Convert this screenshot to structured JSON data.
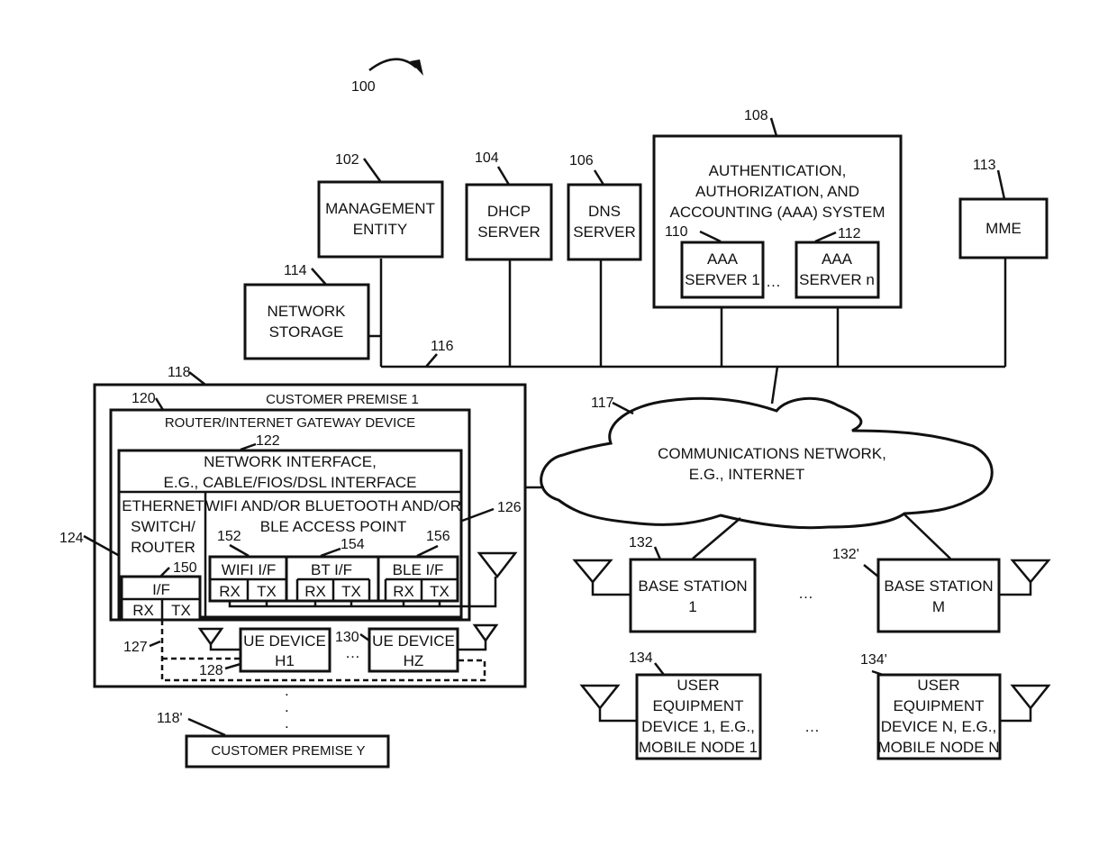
{
  "figure": {
    "ref": "100"
  },
  "nodes": {
    "management_entity": {
      "ref": "102",
      "lines": [
        "MANAGEMENT",
        "ENTITY"
      ]
    },
    "dhcp_server": {
      "ref": "104",
      "lines": [
        "DHCP",
        "SERVER"
      ]
    },
    "dns_server": {
      "ref": "106",
      "lines": [
        "DNS",
        "SERVER"
      ]
    },
    "aaa_system": {
      "ref": "108",
      "lines": [
        "AUTHENTICATION,",
        "AUTHORIZATION, AND",
        "ACCOUNTING (AAA) SYSTEM"
      ]
    },
    "aaa_server_1": {
      "ref": "110",
      "lines": [
        "AAA",
        "SERVER 1"
      ]
    },
    "aaa_server_n": {
      "ref": "112",
      "lines": [
        "AAA",
        "SERVER n"
      ]
    },
    "aaa_ellipsis": "…",
    "mme": {
      "ref": "113",
      "lines": [
        "MME"
      ]
    },
    "network_storage": {
      "ref": "114",
      "lines": [
        "NETWORK",
        "STORAGE"
      ]
    },
    "bus": {
      "ref": "116"
    },
    "comm_network": {
      "ref": "117",
      "lines": [
        "COMMUNICATIONS NETWORK,",
        "E.G., INTERNET"
      ]
    },
    "customer_premise_1": {
      "ref": "118",
      "title": "CUSTOMER PREMISE 1"
    },
    "router_gateway": {
      "ref": "120",
      "title": "ROUTER/INTERNET GATEWAY DEVICE"
    },
    "network_interface": {
      "ref": "122",
      "lines": [
        "NETWORK INTERFACE,",
        "E.G., CABLE/FIOS/DSL INTERFACE"
      ]
    },
    "ethernet_switch": {
      "ref": "124",
      "lines": [
        "ETHERNET",
        "SWITCH/",
        "ROUTER"
      ]
    },
    "access_point": {
      "ref": "126",
      "lines": [
        "WIFI AND/OR BLUETOOTH AND/OR",
        "BLE ACCESS POINT"
      ]
    },
    "wired_link": {
      "ref": "127"
    },
    "ue_device_h1": {
      "ref": "128",
      "lines": [
        "UE DEVICE",
        "H1"
      ]
    },
    "ue_device_hz": {
      "ref": "130",
      "lines": [
        "UE DEVICE",
        "HZ"
      ]
    },
    "ue_ellipsis": "…",
    "eth_if": {
      "ref": "150",
      "label": "I/F",
      "rx": "RX",
      "tx": "TX"
    },
    "wifi_if": {
      "ref": "152",
      "label": "WIFI I/F",
      "rx": "RX",
      "tx": "TX"
    },
    "bt_if": {
      "ref": "154",
      "label": "BT I/F",
      "rx": "RX",
      "tx": "TX"
    },
    "ble_if": {
      "ref": "156",
      "label": "BLE I/F",
      "rx": "RX",
      "tx": "TX"
    },
    "premise_ellipsis": [
      ".",
      ".",
      "."
    ],
    "customer_premise_y": {
      "ref": "118'",
      "title": "CUSTOMER PREMISE Y"
    },
    "base_station_1": {
      "ref": "132",
      "lines": [
        "BASE STATION",
        "1"
      ]
    },
    "base_station_m": {
      "ref": "132'",
      "lines": [
        "BASE STATION",
        "M"
      ]
    },
    "bs_ellipsis": "…",
    "ue_1": {
      "ref": "134",
      "lines": [
        "USER",
        "EQUIPMENT",
        "DEVICE 1, E.G.,",
        "MOBILE NODE 1"
      ]
    },
    "ue_n": {
      "ref": "134'",
      "lines": [
        "USER",
        "EQUIPMENT",
        "DEVICE N, E.G.,",
        "MOBILE NODE N"
      ]
    },
    "ue_mobile_ellipsis": "…"
  }
}
